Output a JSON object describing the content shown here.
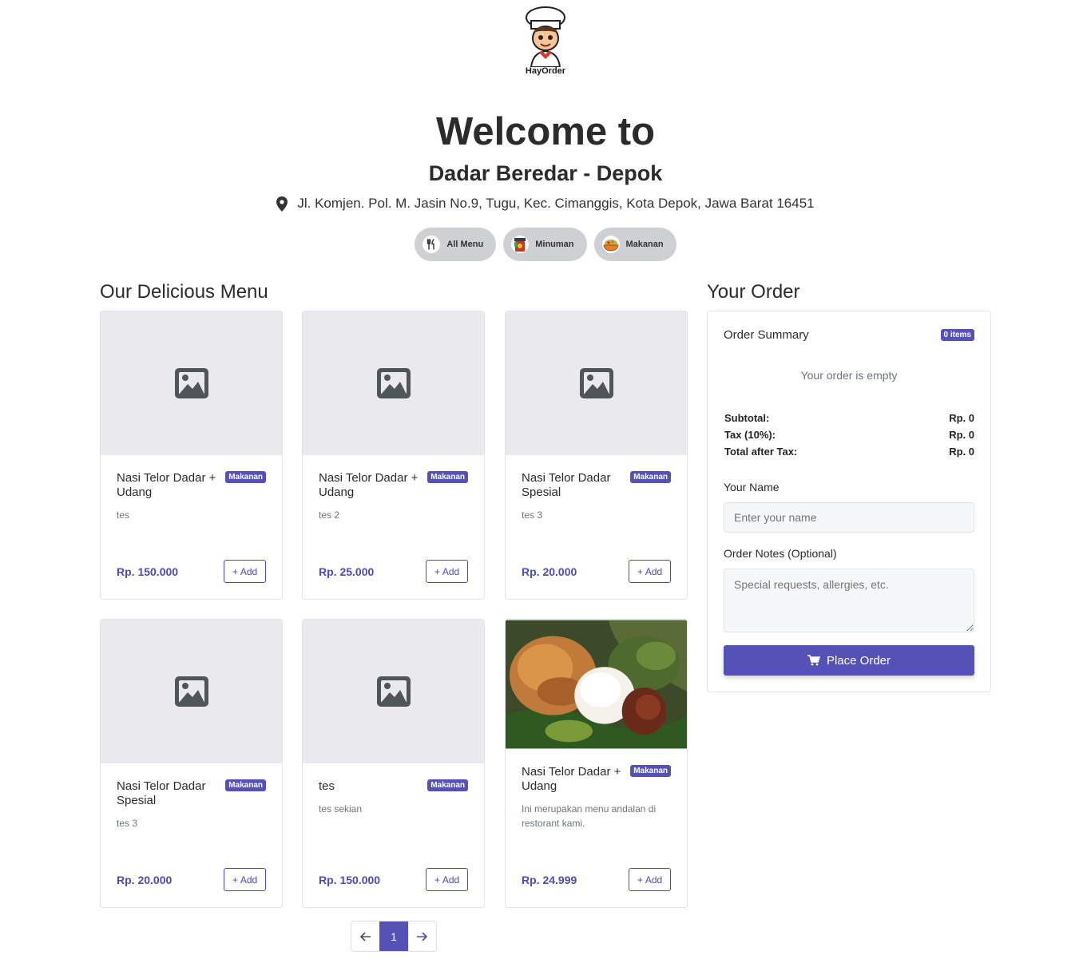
{
  "brand": {
    "logo_text": "HayOrder"
  },
  "hero": {
    "welcome": "Welcome to",
    "store_name": "Dadar Beredar - Depok",
    "address": "Jl. Komjen. Pol. M. Jasin No.9, Tugu, Kec. Cimanggis, Kota Depok, Jawa Barat 16451"
  },
  "filters": [
    {
      "label": "All Menu",
      "icon": "utensils-icon"
    },
    {
      "label": "Minuman",
      "icon": "drink-icon"
    },
    {
      "label": "Makanan",
      "icon": "food-bowl-icon"
    }
  ],
  "menu": {
    "title": "Our Delicious Menu",
    "add_label": "Add",
    "items": [
      {
        "name": "Nasi Telor Dadar + Udang",
        "category": "Makanan",
        "desc": "tes",
        "price": "Rp. 150.000",
        "image": "placeholder"
      },
      {
        "name": "Nasi Telor Dadar + Udang",
        "category": "Makanan",
        "desc": "tes 2",
        "price": "Rp. 25.000",
        "image": "placeholder"
      },
      {
        "name": "Nasi Telor Dadar Spesial",
        "category": "Makanan",
        "desc": "tes 3",
        "price": "Rp. 20.000",
        "image": "placeholder"
      },
      {
        "name": "Nasi Telor Dadar Spesial",
        "category": "Makanan",
        "desc": "tes 3",
        "price": "Rp. 20.000",
        "image": "placeholder"
      },
      {
        "name": "tes",
        "category": "Makanan",
        "desc": "tes sekian",
        "price": "Rp. 150.000",
        "image": "placeholder"
      },
      {
        "name": "Nasi Telor Dadar + Udang",
        "category": "Makanan",
        "desc": "Ini merupakan menu andalan di restorant kami.",
        "price": "Rp. 24.999",
        "image": "food-photo"
      }
    ]
  },
  "pagination": {
    "current": "1"
  },
  "order": {
    "title": "Your Order",
    "summary_label": "Order Summary",
    "count": "0 items",
    "empty_text": "Your order is empty",
    "subtotal_label": "Subtotal:",
    "subtotal": "Rp. 0",
    "tax_label": "Tax (10%):",
    "tax": "Rp. 0",
    "total_label": "Total after Tax:",
    "total": "Rp. 0",
    "name_label": "Your Name",
    "name_placeholder": "Enter your name",
    "notes_label": "Order Notes (Optional)",
    "notes_placeholder": "Special requests, allergies, etc.",
    "place_label": "Place Order"
  },
  "colors": {
    "accent": "#5551b6",
    "price": "#4b4bb0",
    "pill": "#ced0d4"
  }
}
